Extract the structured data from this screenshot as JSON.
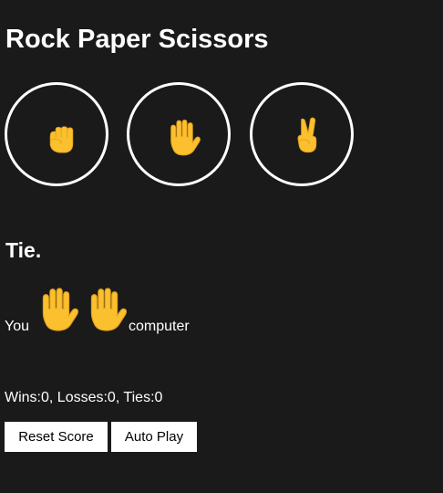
{
  "app": {
    "title": "Rock Paper Scissors"
  },
  "moves": [
    {
      "name": "rock",
      "icon": "raised-fist-icon"
    },
    {
      "name": "paper",
      "icon": "raised-hand-icon"
    },
    {
      "name": "scissors",
      "icon": "victory-hand-icon"
    }
  ],
  "result": {
    "text": "Tie."
  },
  "played": {
    "you_label": "You",
    "you_move_icon": "raised-hand-icon",
    "computer_move_icon": "raised-hand-icon",
    "computer_label": "computer"
  },
  "score": {
    "text": "Wins:0, Losses:0, Ties:0"
  },
  "actions": {
    "reset_label": "Reset Score",
    "auto_play_label": "Auto Play"
  },
  "colors": {
    "background": "#1a1a1a",
    "emoji_yellow": "#fbc02d"
  }
}
